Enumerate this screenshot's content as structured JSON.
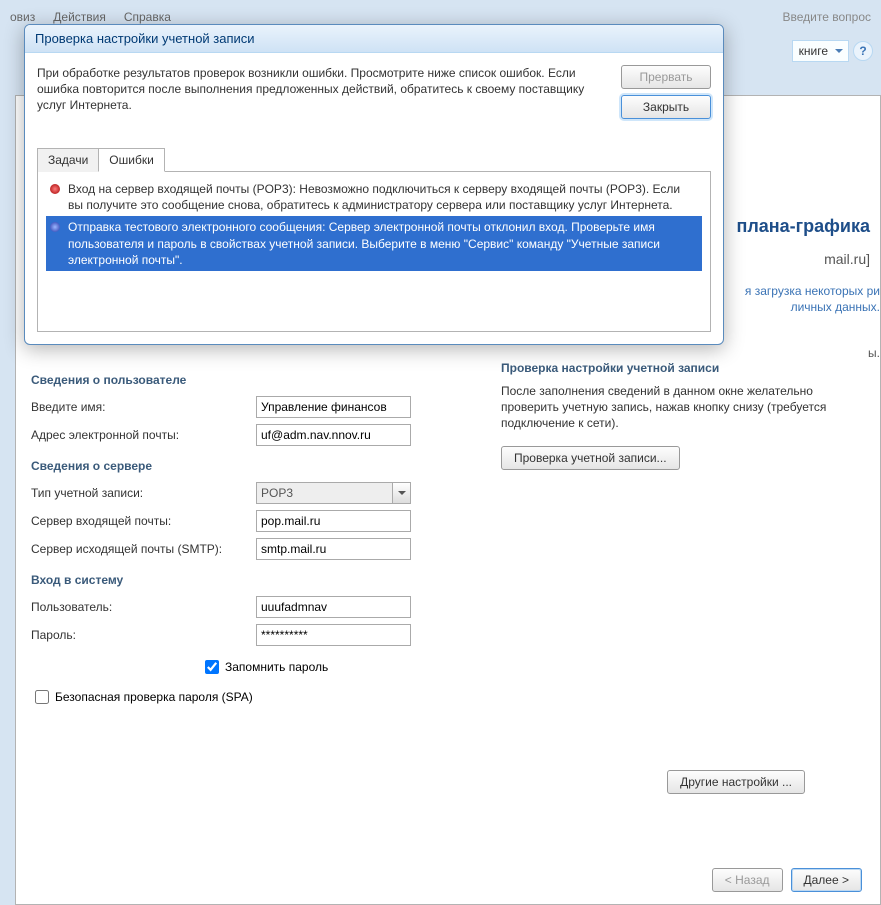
{
  "bg": {
    "menu1": "овиз",
    "menu2": "Действия",
    "menu3": "Справка",
    "search_hint": "Введите вопрос",
    "book_combo": "книге",
    "title_right": "плана-графика",
    "mail_right": "mail.ru]",
    "link1": "я загрузка некоторых ри",
    "link2": "личных данных.",
    "dot": "ы."
  },
  "settings": {
    "user_section": "Сведения о пользователе",
    "name_label": "Введите имя:",
    "name_value": "Управление финансов",
    "email_label": "Адрес электронной почты:",
    "email_value": "uf@adm.nav.nnov.ru",
    "server_section": "Сведения о сервере",
    "account_type_label": "Тип учетной записи:",
    "account_type_value": "POP3",
    "incoming_label": "Сервер входящей почты:",
    "incoming_value": "pop.mail.ru",
    "outgoing_label": "Сервер исходящей почты (SMTP):",
    "outgoing_value": "smtp.mail.ru",
    "login_section": "Вход в систему",
    "user_label": "Пользователь:",
    "user_value": "uuufadmnav",
    "pass_label": "Пароль:",
    "pass_value": "**********",
    "remember": "Запомнить пароль",
    "spa": "Безопасная проверка пароля (SPA)",
    "right_section": "Проверка настройки учетной записи",
    "right_text": "После заполнения сведений в данном окне желательно проверить учетную запись, нажав кнопку снизу (требуется подключение к сети).",
    "check_btn": "Проверка учетной записи...",
    "other_btn": "Другие настройки ...",
    "back_btn": "< Назад",
    "next_btn": "Далее >"
  },
  "dialog": {
    "title": "Проверка настройки учетной записи",
    "message": "При обработке результатов проверок возникли ошибки. Просмотрите ниже список ошибок. Если ошибка повторится после выполнения предложенных действий, обратитесь к своему поставщику услуг Интернета.",
    "abort_btn": "Прервать",
    "close_btn": "Закрыть",
    "tab_tasks": "Задачи",
    "tab_errors": "Ошибки",
    "err1": "Вход на сервер входящей почты (POP3): Невозможно подключиться к серверу входящей почты (POP3). Если вы получите это сообщение снова, обратитесь к администратору сервера или поставщику услуг Интернета.",
    "err2": "Отправка тестового электронного сообщения: Сервер электронной почты отклонил вход. Проверьте имя пользователя и пароль в свойствах учетной записи. Выберите в меню \"Сервис\" команду \"Учетные записи электронной почты\"."
  }
}
